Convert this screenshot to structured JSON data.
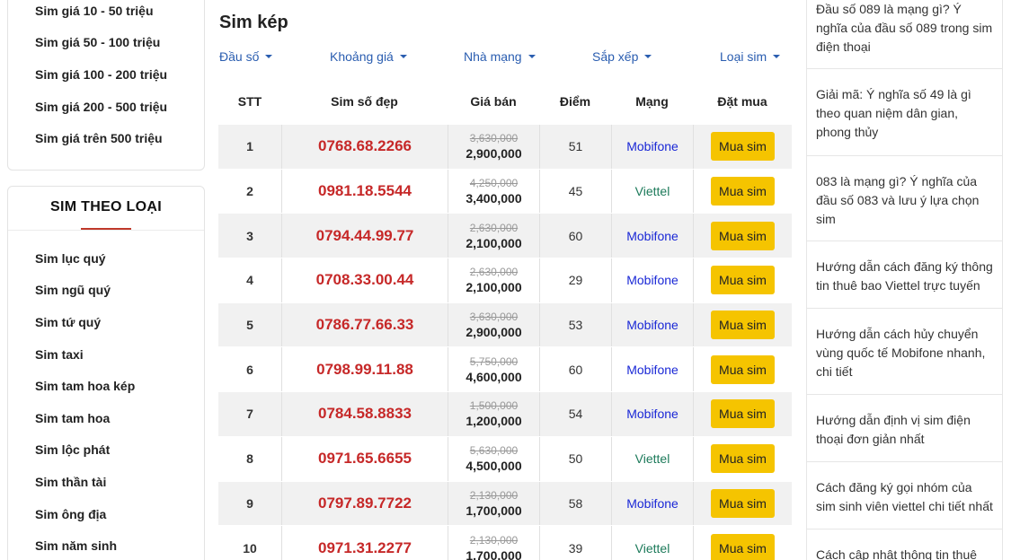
{
  "price_menu": [
    "Sim giá 10 - 50 triệu",
    "Sim giá 50 - 100 triệu",
    "Sim giá 100 - 200 triệu",
    "Sim giá 200 - 500 triệu",
    "Sim giá trên 500 triệu"
  ],
  "type_menu": {
    "title": "SIM THEO LOẠI",
    "items": [
      "Sim lục quý",
      "Sim ngũ quý",
      "Sim tứ quý",
      "Sim taxi",
      "Sim tam hoa kép",
      "Sim tam hoa",
      "Sim lộc phát",
      "Sim thần tài",
      "Sim ông địa",
      "Sim năm sinh"
    ]
  },
  "main": {
    "title": "Sim kép",
    "filters": [
      "Đầu số",
      "Khoảng giá",
      "Nhà mạng",
      "Sắp xếp",
      "Loại sim"
    ],
    "columns": [
      "STT",
      "Sim số đẹp",
      "Giá bán",
      "Điểm",
      "Mạng",
      "Đặt mua"
    ],
    "buy_label": "Mua sim",
    "rows": [
      {
        "stt": "1",
        "number": "0768.68.2266",
        "old_price": "3,630,000",
        "price": "2,900,000",
        "score": "51",
        "network": "Mobifone"
      },
      {
        "stt": "2",
        "number": "0981.18.5544",
        "old_price": "4,250,000",
        "price": "3,400,000",
        "score": "45",
        "network": "Viettel"
      },
      {
        "stt": "3",
        "number": "0794.44.99.77",
        "old_price": "2,630,000",
        "price": "2,100,000",
        "score": "60",
        "network": "Mobifone"
      },
      {
        "stt": "4",
        "number": "0708.33.00.44",
        "old_price": "2,630,000",
        "price": "2,100,000",
        "score": "29",
        "network": "Mobifone"
      },
      {
        "stt": "5",
        "number": "0786.77.66.33",
        "old_price": "3,630,000",
        "price": "2,900,000",
        "score": "53",
        "network": "Mobifone"
      },
      {
        "stt": "6",
        "number": "0798.99.11.88",
        "old_price": "5,750,000",
        "price": "4,600,000",
        "score": "60",
        "network": "Mobifone"
      },
      {
        "stt": "7",
        "number": "0784.58.8833",
        "old_price": "1,500,000",
        "price": "1,200,000",
        "score": "54",
        "network": "Mobifone"
      },
      {
        "stt": "8",
        "number": "0971.65.6655",
        "old_price": "5,630,000",
        "price": "4,500,000",
        "score": "50",
        "network": "Viettel"
      },
      {
        "stt": "9",
        "number": "0797.89.7722",
        "old_price": "2,130,000",
        "price": "1,700,000",
        "score": "58",
        "network": "Mobifone"
      },
      {
        "stt": "10",
        "number": "0971.31.2277",
        "old_price": "2,130,000",
        "price": "1,700,000",
        "score": "39",
        "network": "Viettel"
      }
    ]
  },
  "news": [
    "Đầu số 089 là mạng gì? Ý nghĩa của đầu số 089 trong sim điện thoại",
    "Giải mã: Ý nghĩa số 49 là gì theo quan niệm dân gian, phong thủy",
    "083 là mạng gì? Ý nghĩa của đầu số 083 và lưu ý lựa chọn sim",
    "Hướng dẫn cách đăng ký thông tin thuê bao Viettel trực tuyến",
    "Hướng dẫn cách hủy chuyển vùng quốc tế Mobifone nhanh, chi tiết",
    "Hướng dẫn định vị sim điện thoại đơn giản nhất",
    "Cách đăng ký gọi nhóm của sim sinh viên viettel chi tiết nhất",
    "Cách cập nhật thông tin thuê"
  ],
  "colors": {
    "accent_red": "#c62828",
    "button_yellow": "#f5c400",
    "mobifone": "#1a28d6",
    "viettel": "#1c7a5a",
    "link_blue": "#2a5db0"
  }
}
